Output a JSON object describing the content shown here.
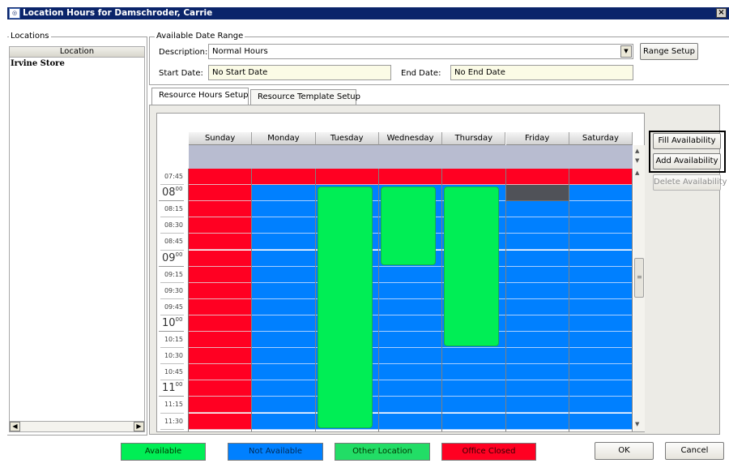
{
  "window": {
    "title": "Location Hours for Damschroder, Carrie",
    "close_glyph": "×",
    "app_icon": "app-icon"
  },
  "locations": {
    "group_label": "Locations",
    "column_header": "Location",
    "items": [
      "Irvine Store"
    ],
    "scroll_left": "◀",
    "scroll_right": "▶"
  },
  "date_range": {
    "group_label": "Available Date Range",
    "description_label": "Description:",
    "description_value": "Normal Hours",
    "dropdown_glyph": "▼",
    "start_label": "Start Date:",
    "start_value": "No Start Date",
    "end_label": "End Date:",
    "end_value": "No End Date",
    "range_setup_button": "Range Setup"
  },
  "tabs": [
    {
      "label": "Resource Hours Setup",
      "active": true
    },
    {
      "label": "Resource Template Setup",
      "active": false
    }
  ],
  "actions": {
    "fill": "Fill Availability",
    "add": "Add Availability",
    "delete": "Delete Availability",
    "delete_enabled": false
  },
  "schedule": {
    "days": [
      "Sunday",
      "Monday",
      "Tuesday",
      "Wednesday",
      "Thursday",
      "Friday",
      "Saturday"
    ],
    "time_rows": [
      {
        "kind": "minor",
        "label": "07:45"
      },
      {
        "kind": "hour",
        "label": "08",
        "sup": "00"
      },
      {
        "kind": "minor",
        "label": "08:15"
      },
      {
        "kind": "minor",
        "label": "08:30"
      },
      {
        "kind": "minor",
        "label": "08:45"
      },
      {
        "kind": "hour",
        "label": "09",
        "sup": "00"
      },
      {
        "kind": "minor",
        "label": "09:15"
      },
      {
        "kind": "minor",
        "label": "09:30"
      },
      {
        "kind": "minor",
        "label": "09:45"
      },
      {
        "kind": "hour",
        "label": "10",
        "sup": "00"
      },
      {
        "kind": "minor",
        "label": "10:15"
      },
      {
        "kind": "minor",
        "label": "10:30"
      },
      {
        "kind": "minor",
        "label": "10:45"
      },
      {
        "kind": "hour",
        "label": "11",
        "sup": "00"
      },
      {
        "kind": "minor",
        "label": "11:15"
      },
      {
        "kind": "minor",
        "label": "11:30"
      }
    ],
    "cell_status": [
      [
        "closed",
        "closed",
        "closed",
        "closed",
        "closed",
        "closed",
        "closed"
      ],
      [
        "closed",
        "not",
        "not",
        "not",
        "not",
        "dark",
        "not"
      ],
      [
        "closed",
        "not",
        "not",
        "not",
        "not",
        "not",
        "not"
      ],
      [
        "closed",
        "not",
        "not",
        "not",
        "not",
        "not",
        "not"
      ],
      [
        "closed",
        "not",
        "not",
        "not",
        "not",
        "not",
        "not"
      ],
      [
        "closed",
        "not",
        "not",
        "not",
        "not",
        "not",
        "not"
      ],
      [
        "closed",
        "not",
        "not",
        "not",
        "not",
        "not",
        "not"
      ],
      [
        "closed",
        "not",
        "not",
        "not",
        "not",
        "not",
        "not"
      ],
      [
        "closed",
        "not",
        "not",
        "not",
        "not",
        "not",
        "not"
      ],
      [
        "closed",
        "not",
        "not",
        "not",
        "not",
        "not",
        "not"
      ],
      [
        "closed",
        "not",
        "not",
        "not",
        "not",
        "not",
        "not"
      ],
      [
        "closed",
        "not",
        "not",
        "not",
        "not",
        "not",
        "not"
      ],
      [
        "closed",
        "not",
        "not",
        "not",
        "not",
        "not",
        "not"
      ],
      [
        "closed",
        "not",
        "not",
        "not",
        "not",
        "not",
        "not"
      ],
      [
        "closed",
        "not",
        "not",
        "not",
        "not",
        "not",
        "not"
      ],
      [
        "closed",
        "not",
        "not",
        "not",
        "not",
        "not",
        "not"
      ]
    ],
    "availability_blocks": [
      {
        "day": "Tuesday",
        "start": "08:00",
        "end": "11:45"
      },
      {
        "day": "Wednesday",
        "start": "08:00",
        "end": "09:15"
      },
      {
        "day": "Thursday",
        "start": "08:00",
        "end": "10:30"
      }
    ],
    "scroll_up": "▲",
    "scroll_down": "▼"
  },
  "legend": [
    {
      "label": "Available",
      "color": "#00ee55",
      "text_color": "#003300"
    },
    {
      "label": "Not Available",
      "color": "#0080ff",
      "text_color": "#002a55"
    },
    {
      "label": "Other Location",
      "color": "#22dd66",
      "text_color": "#003300"
    },
    {
      "label": "Office Closed",
      "color": "#ff0022",
      "text_color": "#330000"
    }
  ],
  "footer": {
    "ok": "OK",
    "cancel": "Cancel"
  },
  "colors": {
    "closed": "#ff0022",
    "closed_line": "#e8b0b8",
    "not_available": "#0080ff",
    "not_available_line": "#a8cfff",
    "dark": "#505258",
    "available": "#00ee55",
    "titlebar": "#0a246a"
  }
}
